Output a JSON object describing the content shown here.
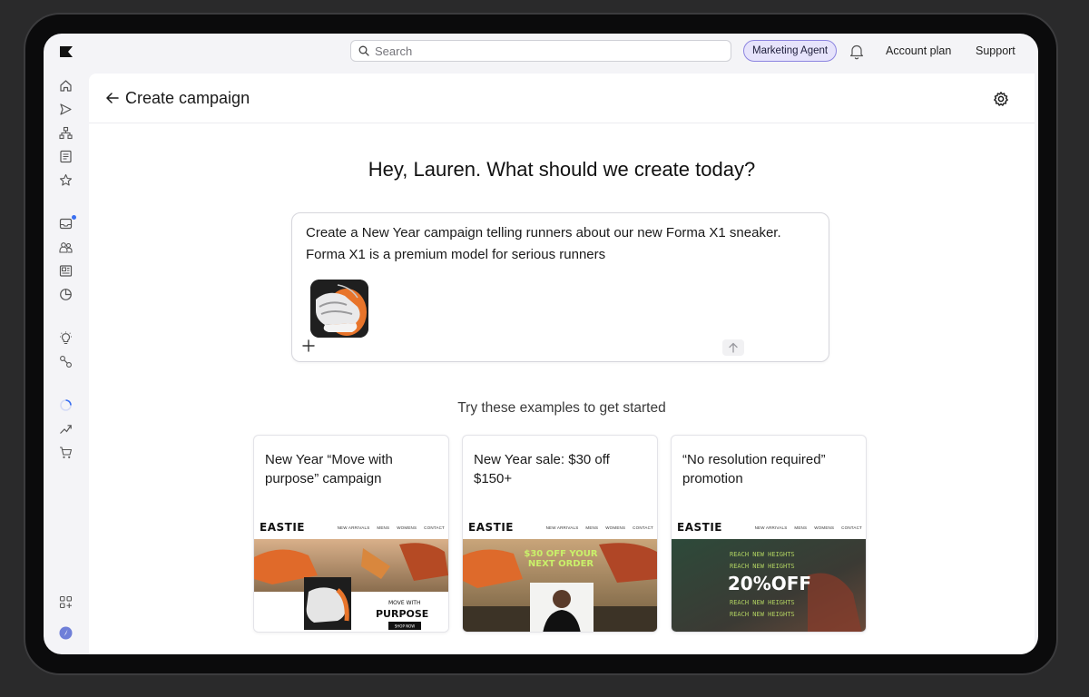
{
  "search": {
    "placeholder": "Search"
  },
  "topbar": {
    "agent_label": "Marketing Agent",
    "account_label": "Account plan",
    "support_label": "Support"
  },
  "header": {
    "title": "Create campaign"
  },
  "main": {
    "greeting": "Hey, Lauren. What should we create today?",
    "prompt_text": "Create a New Year campaign telling runners about our new Forma X1 sneaker. Forma X1 is a premium model for serious runners",
    "examples_label": "Try these examples to get started"
  },
  "cards": [
    {
      "title": "New Year “Move with purpose” campaign",
      "brand": "EASTIE",
      "nav": [
        "NEW ARRIVALS",
        "MENS",
        "WOMENS",
        "CONTACT"
      ],
      "hero_line1": "MOVE WITH",
      "hero_line2": "PURPOSE",
      "cta": "SHOP NOW"
    },
    {
      "title": "New Year sale: $30 off $150+",
      "brand": "EASTIE",
      "nav": [
        "NEW ARRIVALS",
        "MENS",
        "WOMENS",
        "CONTACT"
      ],
      "hero_line1": "$30 OFF YOUR",
      "hero_line2": "NEXT ORDER"
    },
    {
      "title": "“No resolution required” promotion",
      "brand": "EASTIE",
      "nav": [
        "NEW ARRIVALS",
        "MENS",
        "WOMENS",
        "CONTACT"
      ],
      "hero_repeat": "REACH NEW HEIGHTS",
      "hero_big": "20%OFF"
    }
  ],
  "colors": {
    "accent_purple": "#8c84e0",
    "pill_bg": "#e6e3fb",
    "notification_dot": "#3a6ff0",
    "promo_green": "#c9f06a",
    "shoe_orange": "#e8742a"
  }
}
